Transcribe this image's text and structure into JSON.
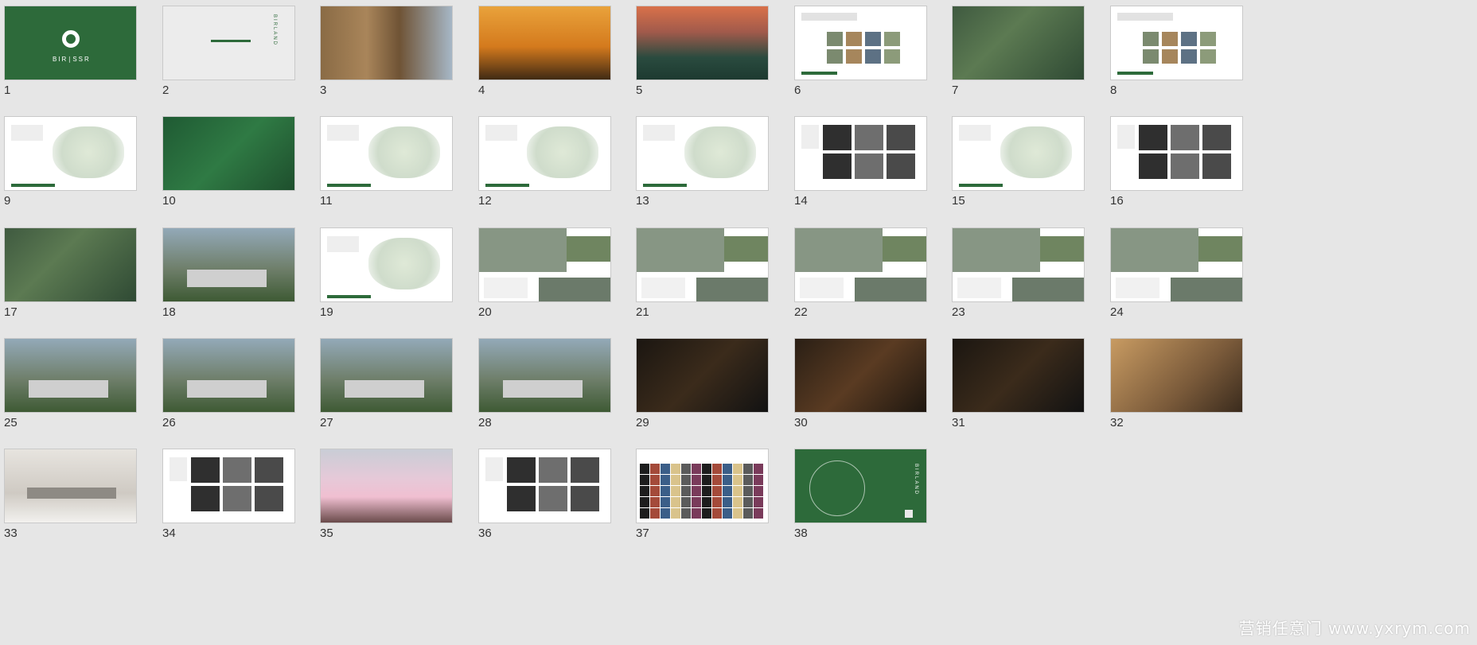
{
  "colors": {
    "background": "#e6e6e6",
    "brand_green": "#2d6a3a",
    "text": "#333333"
  },
  "slides": [
    {
      "number": "1",
      "theme": "green-logo"
    },
    {
      "number": "2",
      "theme": "light-text"
    },
    {
      "number": "3",
      "theme": "hay-photo"
    },
    {
      "number": "4",
      "theme": "sunset-photo"
    },
    {
      "number": "5",
      "theme": "dusk-photo"
    },
    {
      "number": "6",
      "theme": "doc-grid"
    },
    {
      "number": "7",
      "theme": "aerial-photo"
    },
    {
      "number": "8",
      "theme": "doc-grid"
    },
    {
      "number": "9",
      "theme": "doc-map"
    },
    {
      "number": "10",
      "theme": "forest-photo"
    },
    {
      "number": "11",
      "theme": "doc-map"
    },
    {
      "number": "12",
      "theme": "doc-map"
    },
    {
      "number": "13",
      "theme": "doc-map"
    },
    {
      "number": "14",
      "theme": "doc-people"
    },
    {
      "number": "15",
      "theme": "doc-map"
    },
    {
      "number": "16",
      "theme": "doc-people"
    },
    {
      "number": "17",
      "theme": "aerial-photo"
    },
    {
      "number": "18",
      "theme": "render-photo"
    },
    {
      "number": "19",
      "theme": "doc-map"
    },
    {
      "number": "20",
      "theme": "doc-render"
    },
    {
      "number": "21",
      "theme": "doc-render"
    },
    {
      "number": "22",
      "theme": "doc-render"
    },
    {
      "number": "23",
      "theme": "doc-render"
    },
    {
      "number": "24",
      "theme": "doc-render"
    },
    {
      "number": "25",
      "theme": "render-photo"
    },
    {
      "number": "26",
      "theme": "render-photo"
    },
    {
      "number": "27",
      "theme": "render-photo"
    },
    {
      "number": "28",
      "theme": "render-photo"
    },
    {
      "number": "29",
      "theme": "interior-dark"
    },
    {
      "number": "30",
      "theme": "food-dark"
    },
    {
      "number": "31",
      "theme": "interior-dark"
    },
    {
      "number": "32",
      "theme": "food-warm"
    },
    {
      "number": "33",
      "theme": "architecture-light"
    },
    {
      "number": "34",
      "theme": "doc-people"
    },
    {
      "number": "35",
      "theme": "blossom-photo"
    },
    {
      "number": "36",
      "theme": "doc-people"
    },
    {
      "number": "37",
      "theme": "mosaic"
    },
    {
      "number": "38",
      "theme": "green-logo"
    }
  ],
  "slide_texts": {
    "s1_logo": "BIR∣SSR",
    "s2_vertical": "BIRLAND",
    "s38_vertical": "BIRLAND"
  },
  "watermark": "营销任意门 www.yxrym.com"
}
